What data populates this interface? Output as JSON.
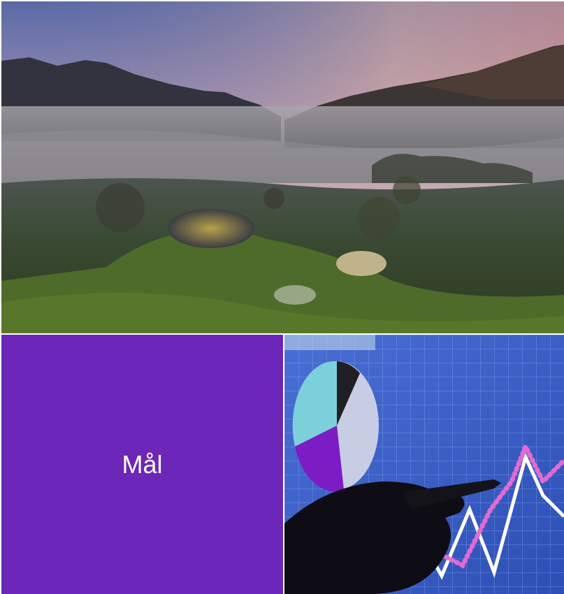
{
  "tiles": {
    "purple_label": "Mål",
    "purple_color": "#6c26b8"
  },
  "photos": {
    "landscape_icon": "misty-mountain-meadow-photo",
    "chart_icon": "hand-pointing-at-chart-photo"
  }
}
